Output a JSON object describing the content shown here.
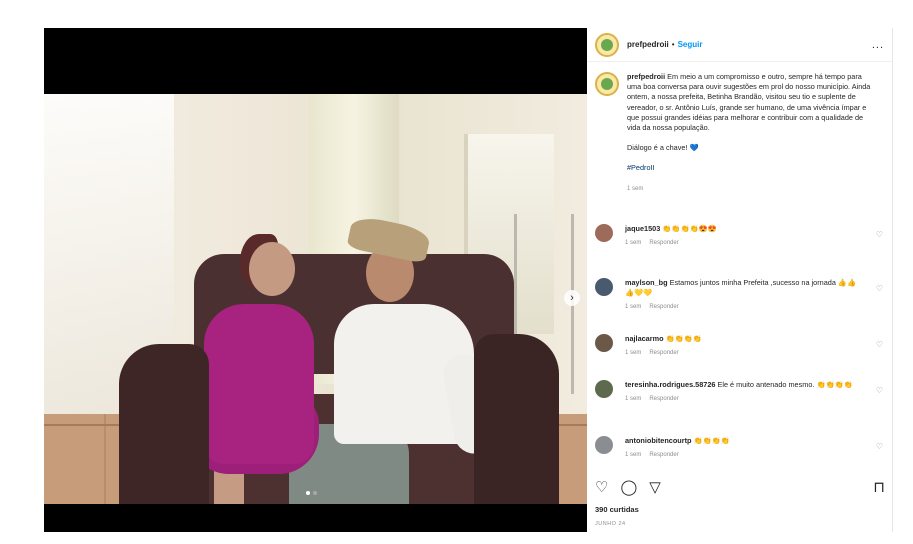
{
  "post": {
    "username": "prefpedroii",
    "separator": "•",
    "follow_label": "Seguir",
    "more_label": "...",
    "caption_username": "prefpedroii",
    "caption_text": "Em meio a um compromisso e outro, sempre há tempo para uma boa conversa para ouvir sugestões em prol do nosso município. Ainda ontem, a nossa prefeita, Betinha Brandão, visitou seu tio e suplente de vereador, o sr. Antônio Luís, grande ser humano, de uma vivência ímpar e que possui grandes idéias para melhorar e contribuir com a qualidade de vida da nossa população.",
    "caption_text2": "Diálogo é a chave!",
    "caption_emoji": "💙",
    "hashtag": "#PedroII",
    "time_ago": "1 sem",
    "likes": "390 curtidas",
    "date": "JUNHO 24"
  },
  "media": {
    "next_icon": "›"
  },
  "comments": [
    {
      "user": "jaque1503",
      "text": "👏👏👏👏😍😍",
      "time": "1 sem",
      "reply": "Responder",
      "avatar_color": "#9c6b5a"
    },
    {
      "user": "maylson_bg",
      "text": "Estamos juntos minha Prefeita ,sucesso na jornada 👍👍👍💛💛",
      "time": "1 sem",
      "reply": "Responder",
      "avatar_color": "#4a5a6e"
    },
    {
      "user": "najlacarmo",
      "text": "👏👏👏👏",
      "time": "1 sem",
      "reply": "Responder",
      "avatar_color": "#6b5848"
    },
    {
      "user": "teresinha.rodrigues.58726",
      "text": "Ele é muito antenado mesmo. 👏👏👏👏",
      "time": "1 sem",
      "reply": "Responder",
      "avatar_color": "#5d6a4e"
    },
    {
      "user": "antoniobitencourtp",
      "text": "👏👏👏👏",
      "time": "1 sem",
      "reply": "Responder",
      "avatar_color": "#8a8e93"
    }
  ],
  "icons": {
    "like": "♡",
    "comment": "◯",
    "share": "▽",
    "bookmark": "⊓",
    "comment_like": "♡"
  }
}
